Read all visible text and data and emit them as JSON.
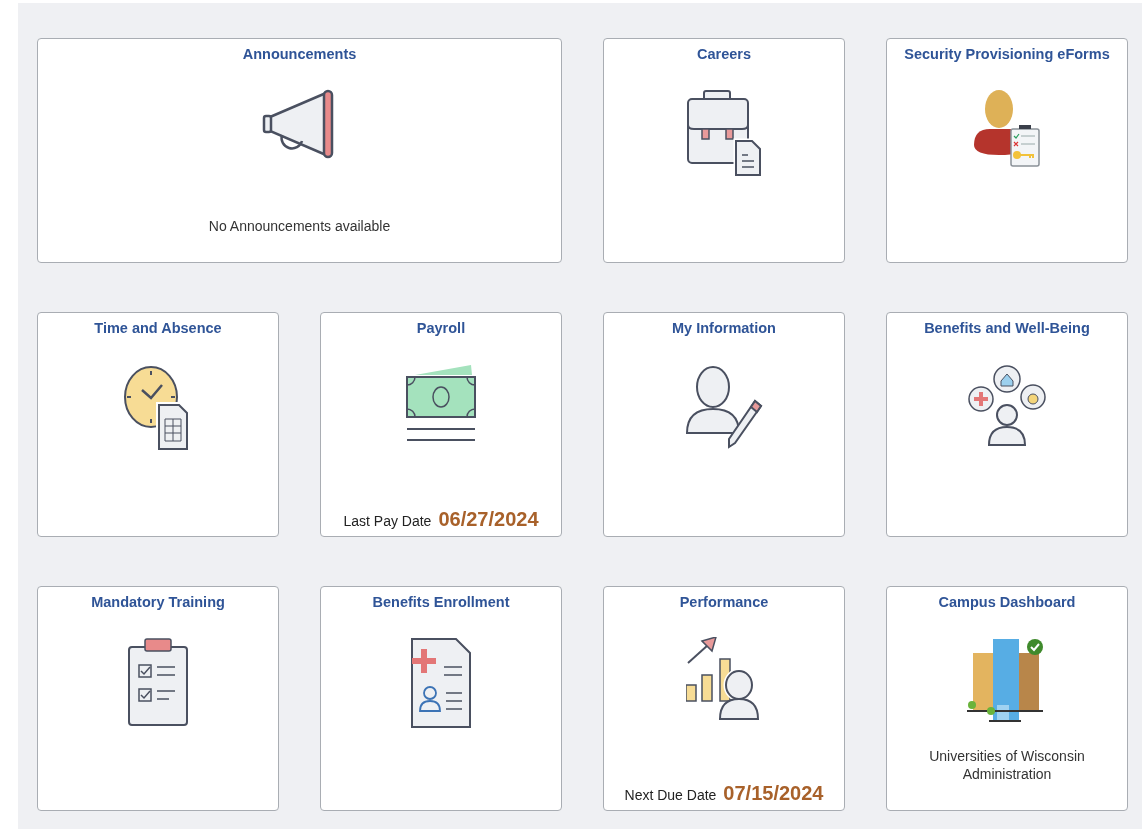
{
  "tiles": [
    {
      "title": "Announcements",
      "kind": "megaphone",
      "wide": true,
      "footer": {
        "kind": "caption",
        "text": "No Announcements available"
      }
    },
    {
      "title": "Careers",
      "kind": "briefcase",
      "wide": false
    },
    {
      "title": "Security Provisioning eForms",
      "kind": "user-clipboard",
      "wide": false
    },
    {
      "title": "Time and Absence",
      "kind": "clock",
      "wide": false
    },
    {
      "title": "Payroll",
      "kind": "money",
      "wide": false,
      "footer": {
        "kind": "date",
        "label": "Last Pay Date",
        "value": "06/27/2024"
      }
    },
    {
      "title": "My Information",
      "kind": "user-pencil",
      "wide": false
    },
    {
      "title": "Benefits and Well-Being",
      "kind": "benefits",
      "wide": false
    },
    {
      "title": "Mandatory Training",
      "kind": "checklist",
      "wide": false
    },
    {
      "title": "Benefits Enrollment",
      "kind": "medical-form",
      "wide": false
    },
    {
      "title": "Performance",
      "kind": "chart-user",
      "wide": false,
      "footer": {
        "kind": "date",
        "label": "Next Due Date",
        "value": "07/15/2024"
      }
    },
    {
      "title": "Campus Dashboard",
      "kind": "buildings",
      "wide": false,
      "footer": {
        "kind": "caption",
        "text": "Universities of Wisconsin Administration"
      }
    }
  ]
}
